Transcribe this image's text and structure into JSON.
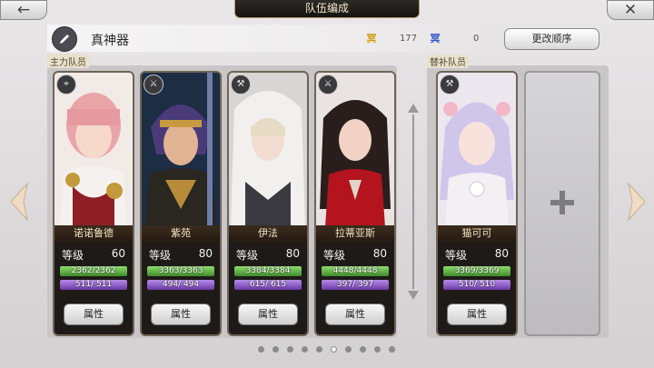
{
  "header": {
    "title": "队伍编成",
    "back_icon": "←",
    "close_icon": "✕"
  },
  "team": {
    "name": "真神器",
    "currency1_icon": "冥",
    "currency1_value": "177",
    "currency2_icon": "冥",
    "currency2_value": "0",
    "reorder_label": "更改顺序"
  },
  "sections": {
    "main_label": "主力队员",
    "sub_label": "替补队员"
  },
  "labels": {
    "level": "等级",
    "attr": "属性"
  },
  "main_members": [
    {
      "name": "诺诺鲁德",
      "level": "60",
      "hp": "2362/2362",
      "hp_frac": 1.0,
      "sp": "511/ 511",
      "sp_frac": 1.0,
      "class_icon": "bow"
    },
    {
      "name": "紫苑",
      "level": "80",
      "hp": "3363/3363",
      "hp_frac": 1.0,
      "sp": "494/ 494",
      "sp_frac": 1.0,
      "class_icon": "sword"
    },
    {
      "name": "伊法",
      "level": "80",
      "hp": "3384/3384",
      "hp_frac": 1.0,
      "sp": "615/ 615",
      "sp_frac": 1.0,
      "class_icon": "hammer"
    },
    {
      "name": "拉蒂亚斯",
      "level": "80",
      "hp": "4448/4448",
      "hp_frac": 1.0,
      "sp": "397/ 397",
      "sp_frac": 1.0,
      "class_icon": "sword"
    }
  ],
  "sub_members": [
    {
      "name": "猫可可",
      "level": "80",
      "hp": "3369/3369",
      "hp_frac": 1.0,
      "sp": "510/ 510",
      "sp_frac": 1.0,
      "class_icon": "axe"
    }
  ],
  "empty_slot_icon": "+",
  "pagination": {
    "count": 10,
    "active_index": 5
  }
}
